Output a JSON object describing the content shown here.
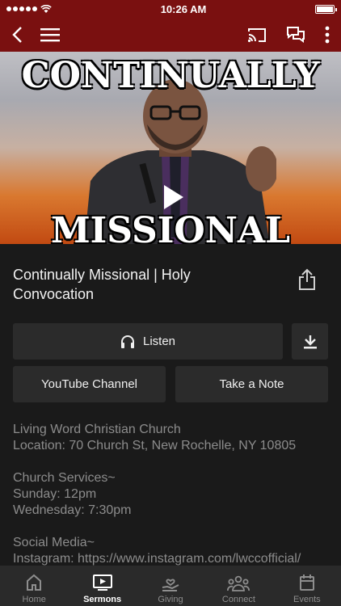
{
  "status": {
    "time": "10:26 AM"
  },
  "hero": {
    "title_top": "CONTINUALLY",
    "title_bottom": "MISSIONAL"
  },
  "sermon": {
    "title": "Continually Missional | Holy Convocation"
  },
  "actions": {
    "listen_label": "Listen",
    "youtube_label": "YouTube Channel",
    "note_label": "Take a Note"
  },
  "description": "Living Word Christian Church\nLocation: 70 Church St, New Rochelle, NY 10805\n\nChurch Services~\nSunday: 12pm\nWednesday: 7:30pm\n\nSocial Media~\nInstagram: https://www.instagram.com/lwccofficial/",
  "tabs": [
    {
      "label": "Home",
      "icon": "home-icon"
    },
    {
      "label": "Sermons",
      "icon": "tv-play-icon"
    },
    {
      "label": "Giving",
      "icon": "giving-hand-icon"
    },
    {
      "label": "Connect",
      "icon": "group-icon"
    },
    {
      "label": "Events",
      "icon": "calendar-icon"
    }
  ],
  "colors": {
    "header": "#7a1010",
    "background": "#1a1a1a",
    "button": "#2b2b2b"
  }
}
